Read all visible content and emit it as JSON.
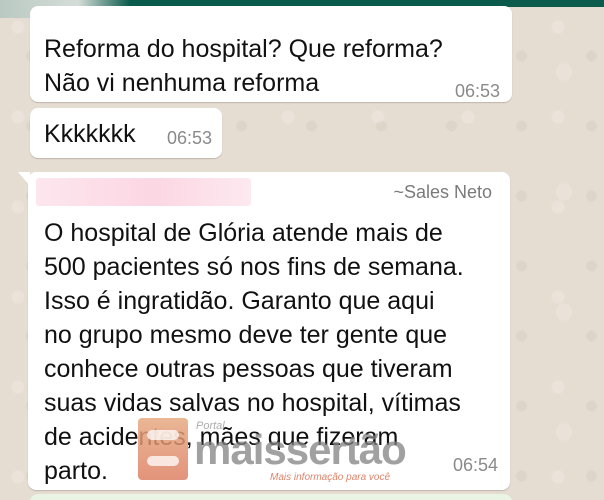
{
  "messages": [
    {
      "text": "Reforma do hospital? Que reforma?\nNão vi nenhuma reforma",
      "time": "06:53"
    },
    {
      "text": "Kkkkkkk",
      "time": "06:53"
    },
    {
      "sender": "~Sales Neto",
      "text": "O hospital de Glória atende mais de\n500 pacientes só nos fins de semana.\nIsso é ingratidão. Garanto que aqui\nno grupo mesmo deve ter gente que\nconhece outras pessoas que tiveram\nsuas vidas salvas no hospital, vítimas\nde acidentes, mães que fizeram\nparto.",
      "time": "06:54"
    }
  ],
  "watermark": {
    "top": "Portal",
    "brand": "maissertão",
    "tagline": "Mais informação para você"
  },
  "colors": {
    "header": "#0b5b4c",
    "bubble": "#ffffff",
    "chat_background": "#e6ddd2"
  }
}
